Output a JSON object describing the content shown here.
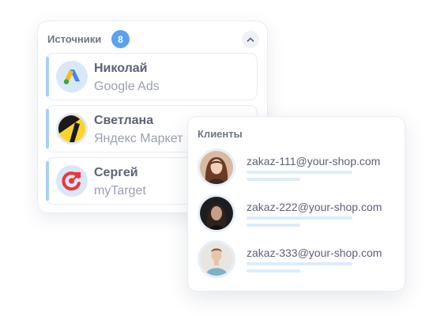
{
  "sources": {
    "title": "Источники",
    "count": "8",
    "items": [
      {
        "name": "Николай",
        "channel": "Google Ads",
        "icon": "google-ads-icon"
      },
      {
        "name": "Светлана",
        "channel": "Яндекс Маркет",
        "icon": "yandex-market-icon"
      },
      {
        "name": "Сергей",
        "channel": "myTarget",
        "icon": "mytarget-icon"
      }
    ]
  },
  "clients": {
    "title": "Клиенты",
    "items": [
      {
        "email": "zakaz-111@your-shop.com"
      },
      {
        "email": "zakaz-222@your-shop.com"
      },
      {
        "email": "zakaz-333@your-shop.com"
      }
    ]
  },
  "colors": {
    "accent": "#5aa2ef",
    "item_bar": "#a9cff5",
    "text_primary": "#5d6178",
    "text_secondary": "#9a9fb0"
  }
}
